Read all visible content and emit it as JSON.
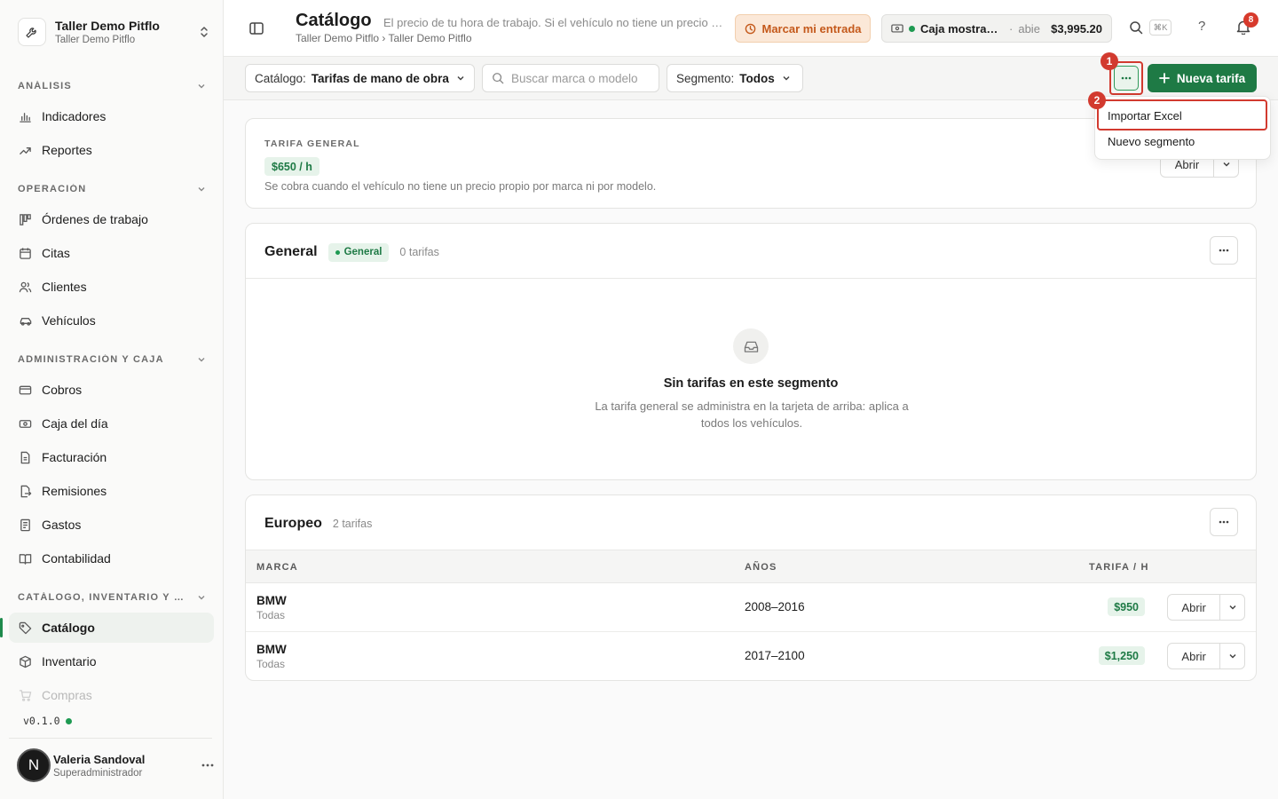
{
  "org": {
    "name": "Taller Demo Pitflo",
    "sub": "Taller Demo Pitflo"
  },
  "sidebar": {
    "sections": [
      {
        "label": "ANÁLISIS"
      },
      {
        "label": "OPERACIÓN"
      },
      {
        "label": "ADMINISTRACIÓN Y CAJA"
      },
      {
        "label": "CATÁLOGO, INVENTARIO Y COMPRAS"
      }
    ],
    "items": [
      {
        "label": "Indicadores",
        "icon": "bar-chart-icon"
      },
      {
        "label": "Reportes",
        "icon": "trend-icon"
      },
      {
        "label": "Órdenes de trabajo",
        "icon": "kanban-icon"
      },
      {
        "label": "Citas",
        "icon": "calendar-icon"
      },
      {
        "label": "Clientes",
        "icon": "users-icon"
      },
      {
        "label": "Vehículos",
        "icon": "car-icon"
      },
      {
        "label": "Cobros",
        "icon": "credit-card-icon"
      },
      {
        "label": "Caja del día",
        "icon": "cash-icon"
      },
      {
        "label": "Facturación",
        "icon": "file-icon"
      },
      {
        "label": "Remisiones",
        "icon": "file-export-icon"
      },
      {
        "label": "Gastos",
        "icon": "receipt-icon"
      },
      {
        "label": "Contabilidad",
        "icon": "book-icon"
      },
      {
        "label": "Catálogo",
        "icon": "tag-icon"
      },
      {
        "label": "Inventario",
        "icon": "box-icon"
      },
      {
        "label": "Compras",
        "icon": "cart-icon"
      }
    ],
    "version": "v0.1.0"
  },
  "user": {
    "initial": "N",
    "name": "Valeria Sandoval",
    "role": "Superadministrador"
  },
  "header": {
    "title": "Catálogo",
    "description": "El precio de tu hora de trabajo. Si el vehículo no tiene un precio propio por marca ni por modelo, se cobra la tarifa general.",
    "breadcrumb": "Taller Demo Pitflo › Taller Demo Pitflo",
    "clock_in_label": "Marcar mi entrada",
    "cashbox": {
      "name": "Caja mostrador",
      "status": "abie",
      "separator": "·",
      "amount": "$3,995.20"
    },
    "search_shortcut": "⌘K",
    "help": "?",
    "notifications_count": "8"
  },
  "toolbar": {
    "catalog_key": "Catálogo:",
    "catalog_value": "Tarifas de mano de obra",
    "search_placeholder": "Buscar marca o modelo",
    "segment_key": "Segmento:",
    "segment_value": "Todos",
    "new_rate_label": "Nueva tarifa"
  },
  "dropdown": {
    "items": [
      "Importar Excel",
      "Nuevo segmento"
    ]
  },
  "markers": {
    "one": "1",
    "two": "2"
  },
  "general_rate": {
    "overline": "TARIFA GENERAL",
    "price": "$650 / h",
    "note": "Se cobra cuando el vehículo no tiene un precio propio por marca ni por modelo.",
    "open_label": "Abrir"
  },
  "segment_general": {
    "title": "General",
    "badge": "General",
    "count": "0 tarifas",
    "empty_title": "Sin tarifas en este segmento",
    "empty_desc": "La tarifa general se administra en la tarjeta de arriba: aplica a todos los vehículos."
  },
  "segment_europeo": {
    "title": "Europeo",
    "count": "2 tarifas",
    "columns": {
      "brand": "MARCA",
      "years": "AÑOS",
      "rate": "TARIFA / H"
    },
    "rows": [
      {
        "brand": "BMW",
        "model": "Todas",
        "years": "2008–2016",
        "rate": "$950",
        "open_label": "Abrir"
      },
      {
        "brand": "BMW",
        "model": "Todas",
        "years": "2017–2100",
        "rate": "$1,250",
        "open_label": "Abrir"
      }
    ]
  },
  "colors": {
    "accent": "#1e7a45",
    "highlight": "#d23a2f",
    "warning_bg": "#fbe8d8",
    "warning_text": "#c4591b"
  }
}
